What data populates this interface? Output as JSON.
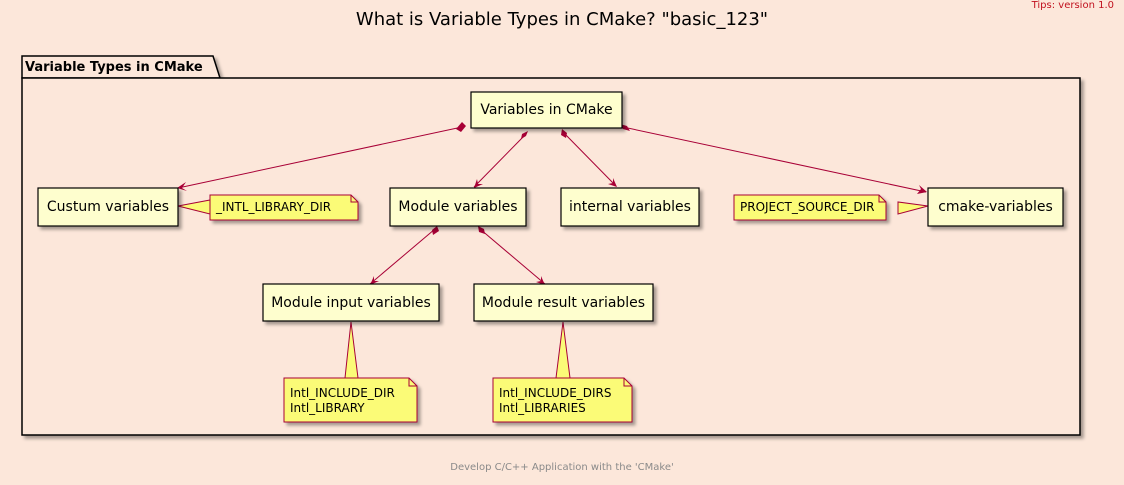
{
  "header": {
    "tips": "Tips: version 1.0"
  },
  "diagram": {
    "title": "What is Variable Types in CMake? \"basic_123\"",
    "package": "Variable Types in CMake",
    "nodes": {
      "root": "Variables in CMake",
      "custum": "Custum variables",
      "module": "Module variables",
      "internal": "internal variables",
      "cmake": "cmake-variables",
      "module_input": "Module input variables",
      "module_result": "Module result variables"
    },
    "notes": {
      "intl_library_dir": "_INTL_LIBRARY_DIR",
      "project_source_dir": "PROJECT_SOURCE_DIR",
      "input_line1": "Intl_INCLUDE_DIR",
      "input_line2": "Intl_LIBRARY",
      "result_line1": "Intl_INCLUDE_DIRS",
      "result_line2": "Intl_LIBRARIES"
    },
    "footer": "Develop C/C++ Application with the 'CMake'"
  },
  "colors": {
    "background": "#FCE7DA",
    "node_fill": "#FEFECE",
    "note_fill": "#FBFB77",
    "arrow": "#A80036",
    "tips": "#C1121F"
  }
}
